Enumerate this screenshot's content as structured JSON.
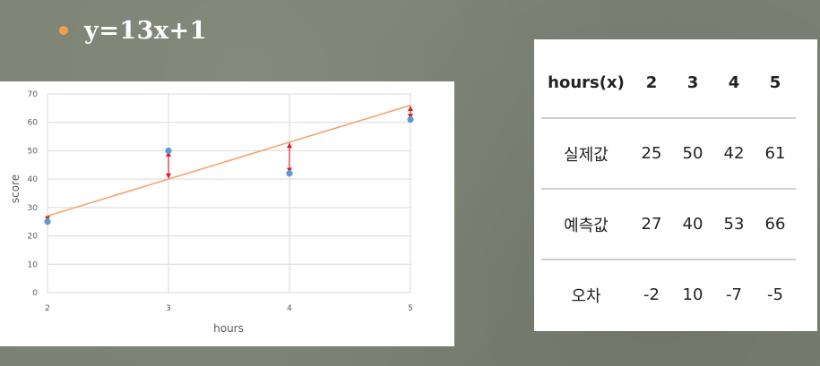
{
  "equation": "y=13x+1",
  "colors": {
    "regression_line": "#f4a46e",
    "actual_points": "#5b9bd5",
    "error_arrows": "#d62020",
    "bullet": "#f0a04b"
  },
  "chart_data": {
    "type": "scatter",
    "xlabel": "hours",
    "ylabel": "score",
    "x": [
      2,
      3,
      4,
      5
    ],
    "xlim": [
      2,
      5
    ],
    "ylim": [
      0,
      70
    ],
    "x_ticks": [
      "2",
      "3",
      "4",
      "5"
    ],
    "y_ticks": [
      "0",
      "10",
      "20",
      "30",
      "40",
      "50",
      "60",
      "70"
    ],
    "grid": true,
    "series": [
      {
        "type": "scatter",
        "values": [
          25,
          50,
          42,
          61
        ]
      },
      {
        "type": "line",
        "values": [
          27,
          40,
          53,
          66
        ]
      }
    ],
    "error_arrows": true
  },
  "table": {
    "header": [
      "hours(x)",
      "2",
      "3",
      "4",
      "5"
    ],
    "rows": [
      [
        "실제값",
        "25",
        "50",
        "42",
        "61"
      ],
      [
        "예측값",
        "27",
        "40",
        "53",
        "66"
      ],
      [
        "오차",
        "-2",
        "10",
        "-7",
        "-5"
      ]
    ]
  }
}
